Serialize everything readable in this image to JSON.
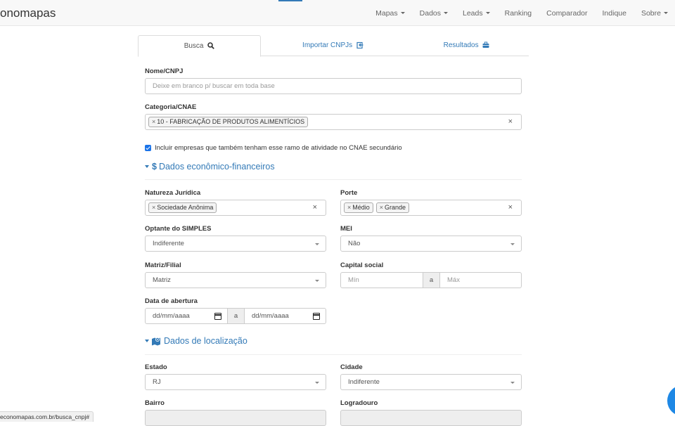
{
  "navbar": {
    "brand": "onomapas",
    "items": [
      {
        "label": "Mapas",
        "dropdown": true
      },
      {
        "label": "Dados",
        "dropdown": true
      },
      {
        "label": "Leads",
        "dropdown": true
      },
      {
        "label": "Ranking",
        "dropdown": false
      },
      {
        "label": "Comparador",
        "dropdown": false
      },
      {
        "label": "Indique",
        "dropdown": false
      },
      {
        "label": "Sobre",
        "dropdown": true
      }
    ]
  },
  "tabs": [
    {
      "label": "Busca",
      "icon": "search-icon",
      "active": true
    },
    {
      "label": "Importar CNPJs",
      "icon": "import-icon",
      "active": false
    },
    {
      "label": "Resultados",
      "icon": "briefcase-icon",
      "active": false
    }
  ],
  "form": {
    "nome_label": "Nome/CNPJ",
    "nome_placeholder": "Deixe em branco p/ buscar em toda base",
    "categoria_label": "Categoria/CNAE",
    "categoria_tag": "10 - FABRICAÇÃO DE PRODUTOS ALIMENTÍCIOS",
    "cnae_checkbox_label": "Incluir empresas que também tenham esse ramo de atividade no CNAE secundário",
    "cnae_checkbox_checked": true,
    "section_financeiro": "Dados econômico-financeiros",
    "natureza_label": "Natureza Jurídica",
    "natureza_tag": "Sociedade Anônima",
    "porte_label": "Porte",
    "porte_tags": [
      "Médio",
      "Grande"
    ],
    "simples_label": "Optante do SIMPLES",
    "simples_value": "Indiferente",
    "mei_label": "MEI",
    "mei_value": "Não",
    "matriz_label": "Matriz/Filial",
    "matriz_value": "Matriz",
    "capital_label": "Capital social",
    "capital_min": "Mín",
    "capital_sep": "a",
    "capital_max": "Máx",
    "abertura_label": "Data de abertura",
    "abertura_start": "dd/mm/aaaa",
    "abertura_sep": "a",
    "abertura_end": "dd/mm/aaaa",
    "section_localizacao": "Dados de localização",
    "estado_label": "Estado",
    "estado_value": "RJ",
    "cidade_label": "Cidade",
    "cidade_value": "Indiferente",
    "bairro_label": "Bairro",
    "logradouro_label": "Logradouro"
  },
  "status_url": "economapas.com.br/busca_cnpj#",
  "colors": {
    "accent": "#337ab7",
    "checkbox": "#1a73e8",
    "fab": "#1e88e5"
  }
}
